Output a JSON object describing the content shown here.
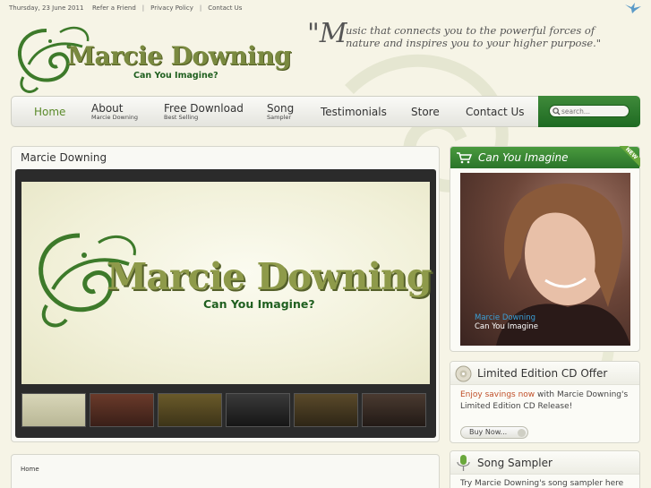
{
  "topbar": {
    "date": "Thursday, 23 June 2011",
    "links": [
      "Refer a Friend",
      "Privacy Policy",
      "Contact Us"
    ]
  },
  "brand": {
    "name": "Marcie Downing",
    "subtitle": "Can You Imagine?"
  },
  "tagline": {
    "mark": "\"M",
    "text": "usic that connects you to the powerful forces of nature and inspires you to your higher purpose.\""
  },
  "nav": {
    "items": [
      {
        "label": "Home",
        "sub": ""
      },
      {
        "label": "About",
        "sub": "Marcie Downing"
      },
      {
        "label": "Free Download",
        "sub": "Best Selling"
      },
      {
        "label": "Song",
        "sub": "Sampler"
      },
      {
        "label": "Testimonials",
        "sub": ""
      },
      {
        "label": "Store",
        "sub": ""
      },
      {
        "label": "Contact Us",
        "sub": ""
      }
    ],
    "search_placeholder": "search..."
  },
  "main": {
    "title": "Marcie Downing",
    "slide": {
      "title": "Marcie Downing",
      "subtitle": "Can You Imagine?"
    },
    "thumbnail_count": 6
  },
  "breadcrumb": "Home",
  "sidebar": {
    "album": {
      "title": "Can You Imagine",
      "badge": "NEW",
      "cover_name": "Marcie Downing",
      "cover_sub": "Can You Imagine"
    },
    "cd_offer": {
      "title": "Limited Edition CD Offer",
      "highlight": "Enjoy savings now",
      "text": " with Marcie Downing's Limited Edition CD Release!",
      "button": "Buy Now..."
    },
    "sampler": {
      "title": "Song Sampler",
      "text": "Try Marcie Downing's song sampler here on"
    }
  },
  "colors": {
    "background": "#f6f4e6",
    "accent_green": "#2a742a",
    "nav_active": "#5a8a2a",
    "highlight": "#c0502a"
  }
}
